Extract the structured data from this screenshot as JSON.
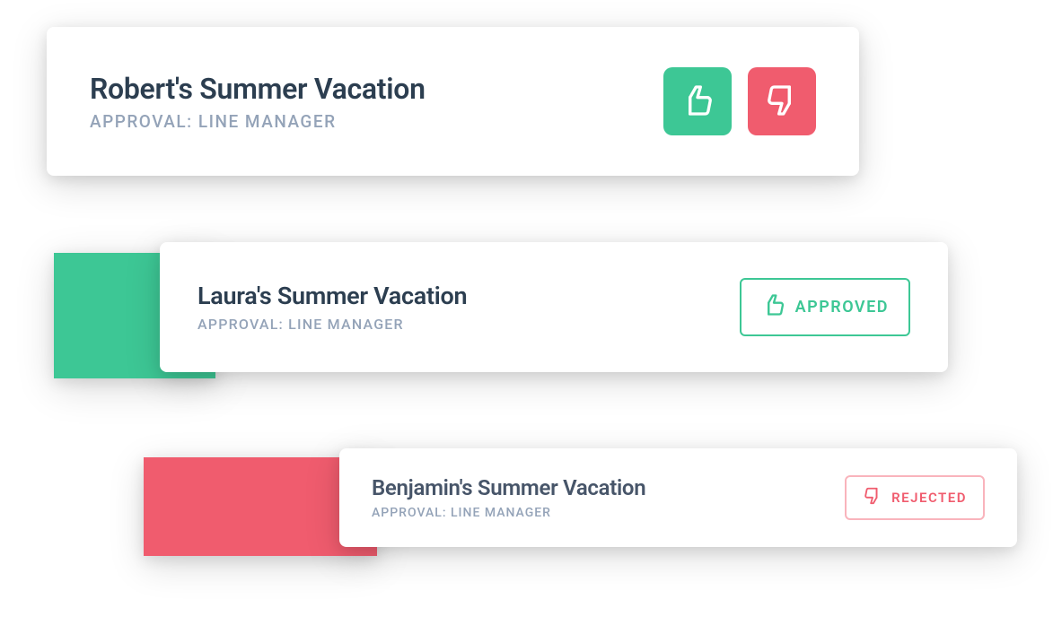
{
  "colors": {
    "approve": "#3dc795",
    "reject": "#f05c6e"
  },
  "cards": [
    {
      "title": "Robert's Summer Vacation",
      "subtitle": "APPROVAL: LINE MANAGER",
      "state": "pending"
    },
    {
      "title": "Laura's Summer Vacation",
      "subtitle": "APPROVAL: LINE MANAGER",
      "state": "approved",
      "status_label": "APPROVED"
    },
    {
      "title": "Benjamin's Summer Vacation",
      "subtitle": "APPROVAL: LINE MANAGER",
      "state": "rejected",
      "status_label": "REJECTED"
    }
  ]
}
